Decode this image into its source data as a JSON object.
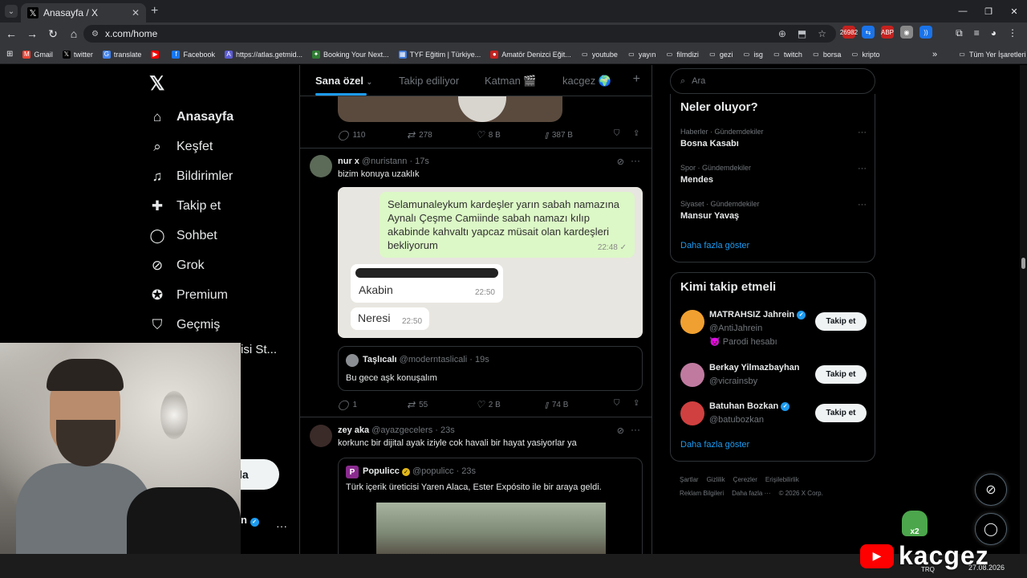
{
  "browser": {
    "tab_title": "Anasayfa / X",
    "tab_icon": "𝕏",
    "url": "x.com/home",
    "extensions": [
      {
        "label": "26982",
        "color": "#c5221f"
      },
      {
        "label": "⇆",
        "color": "#1a73e8"
      },
      {
        "label": "ABP",
        "color": "#c5221f"
      },
      {
        "label": "◉",
        "color": "#888888"
      },
      {
        "label": "))",
        "color": "#1a73e8"
      }
    ],
    "bookmarks": [
      {
        "label": "Gmail",
        "icon": "M",
        "color": "#ea4335"
      },
      {
        "label": "twitter",
        "icon": "𝕏",
        "color": "#000000"
      },
      {
        "label": "translate",
        "icon": "G",
        "color": "#4285f4"
      },
      {
        "label": "",
        "icon": "▶",
        "color": "#ff0000"
      },
      {
        "label": "Facebook",
        "icon": "f",
        "color": "#1877f2"
      },
      {
        "label": "https://atlas.getmid...",
        "icon": "A",
        "color": "#5b5bd6"
      },
      {
        "label": "Booking Your Next...",
        "icon": "✦",
        "color": "#2e7d32"
      },
      {
        "label": "TYF Eğitim | Türkiye...",
        "icon": "▦",
        "color": "#3c78d8"
      },
      {
        "label": "Amatör Denizci Eğit...",
        "icon": "●",
        "color": "#c5221f"
      },
      {
        "label": "youtube",
        "icon": "▭",
        "color": "transparent"
      },
      {
        "label": "yayın",
        "icon": "▭",
        "color": "transparent"
      },
      {
        "label": "filmdizi",
        "icon": "▭",
        "color": "transparent"
      },
      {
        "label": "gezi",
        "icon": "▭",
        "color": "transparent"
      },
      {
        "label": "isg",
        "icon": "▭",
        "color": "transparent"
      },
      {
        "label": "twitch",
        "icon": "▭",
        "color": "transparent"
      },
      {
        "label": "borsa",
        "icon": "▭",
        "color": "transparent"
      },
      {
        "label": "kripto",
        "icon": "▭",
        "color": "transparent"
      }
    ],
    "bookmarks_more": "»",
    "all_bookmarks": "Tüm Yer İşaretleri"
  },
  "sidebar": {
    "logo": "𝕏",
    "items": [
      {
        "label": "Anasayfa",
        "icon": "⌂",
        "icon_name": "home-icon"
      },
      {
        "label": "Keşfet",
        "icon": "⌕",
        "icon_name": "search-icon"
      },
      {
        "label": "Bildirimler",
        "icon": "♫",
        "icon_name": "bell-icon"
      },
      {
        "label": "Takip et",
        "icon": "✚",
        "icon_name": "follow-icon"
      },
      {
        "label": "Sohbet",
        "icon": "◯",
        "icon_name": "chat-icon"
      },
      {
        "label": "Grok",
        "icon": "⊘",
        "icon_name": "grok-icon"
      },
      {
        "label": "Premium",
        "icon": "✪",
        "icon_name": "premium-icon"
      },
      {
        "label": "Geçmiş",
        "icon": "⛉",
        "icon_name": "bookmark-icon"
      }
    ],
    "partial_item": "isi St...",
    "post_button": "la",
    "account_partial": "n"
  },
  "feed": {
    "tabs": [
      "Sana özel",
      "Takip ediliyor",
      "Katman 🎬",
      "kacgez 🌍"
    ],
    "tab_plus": "+",
    "post0": {
      "replies": "110",
      "reposts": "278",
      "likes": "8 B",
      "views": "387 B"
    },
    "post1": {
      "name": "nur x",
      "handle": "@nuristann · 17s",
      "text": "bizim konuya uzaklık",
      "chat": {
        "out_message": "Selamunaleykum kardeşler yarın sabah namazına Aynalı Çeşme Camiinde sabah namazı kılıp akabinde kahvaltı yapcaz müsait olan kardeşleri bekliyorum",
        "out_time": "22:48 ✓",
        "in1_text": "Akabin",
        "in1_time": "22:50",
        "in2_text": "Neresi",
        "in2_time": "22:50"
      },
      "quote": {
        "name": "Taşlıcalı",
        "handle": "@moderntaslicali · 19s",
        "text": "Bu gece aşk konuşalım"
      },
      "replies": "1",
      "reposts": "55",
      "likes": "2 B",
      "views": "74 B"
    },
    "post2": {
      "name": "zey aka",
      "handle": "@ayazgecelers · 23s",
      "text": "korkunc bir dijital ayak iziyle cok havali bir hayat yasiyorlar ya",
      "quote": {
        "name": "Populicc",
        "handle": "@populicc · 23s",
        "text": "Türk içerik üreticisi Yaren Alaca, Ester Expósito ile bir araya geldi."
      }
    }
  },
  "right": {
    "search_placeholder": "Ara",
    "trends_title": "Neler oluyor?",
    "trends": [
      {
        "category": "Haberler · Gündemdekiler",
        "name": "Bosna Kasabı"
      },
      {
        "category": "Spor · Gündemdekiler",
        "name": "Mendes"
      },
      {
        "category": "Siyaset · Gündemdekiler",
        "name": "Mansur Yavaş"
      }
    ],
    "show_more": "Daha fazla göster",
    "who_title": "Kimi takip etmeli",
    "who": [
      {
        "name": "MATRAHSIZ Jahrein",
        "handle": "@AntiJahrein",
        "extra": "😈 Parodi hesabı",
        "verified": true,
        "color": "#f0a030"
      },
      {
        "name": "Berkay Yilmazbayhan",
        "handle": "@vicrainsby",
        "extra": "",
        "verified": false,
        "color": "#c07aa0"
      },
      {
        "name": "Batuhan Bozkan",
        "handle": "@batubozkan",
        "extra": "",
        "verified": true,
        "color": "#d04040"
      }
    ],
    "follow_label": "Takip et",
    "footer": [
      "Şartlar",
      "Gizlilik",
      "Çerezler",
      "Erişilebilirlik",
      "Reklam Bilgileri",
      "Daha fazla ···",
      "© 2026 X Corp."
    ]
  },
  "overlay": {
    "brand": "kacgez",
    "frog_label": "x2",
    "clock": "27.08.2026",
    "lang": "TRQ"
  },
  "colors": {
    "accent": "#1d9bf0",
    "bg": "#000000",
    "border": "#2f3336",
    "muted": "#71767b"
  }
}
